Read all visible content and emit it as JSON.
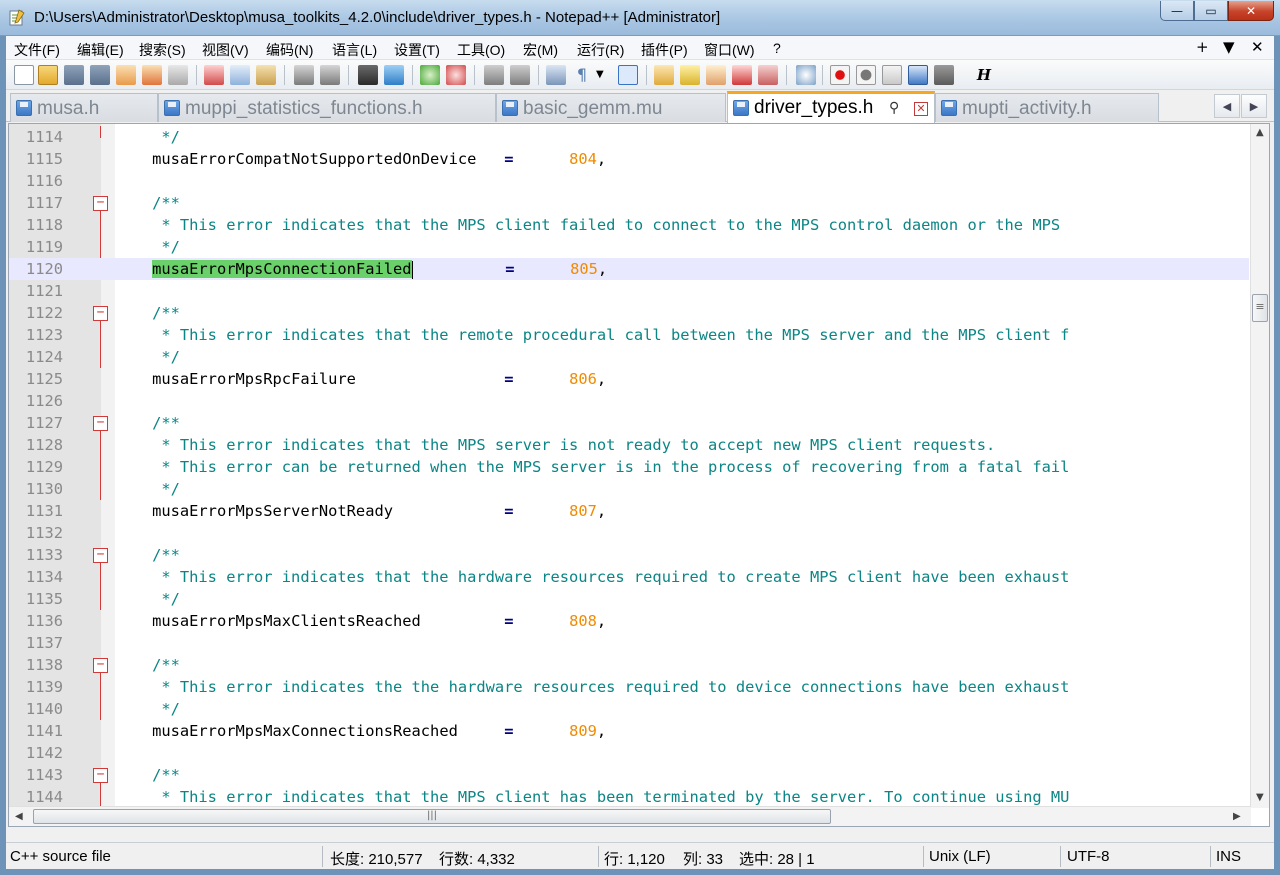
{
  "window": {
    "title": "D:\\Users\\Administrator\\Desktop\\musa_toolkits_4.2.0\\include\\driver_types.h - Notepad++ [Administrator]",
    "minimize": "—",
    "maximize": "▭",
    "close": "✕"
  },
  "menu": {
    "items": [
      "文件(F)",
      "编辑(E)",
      "搜索(S)",
      "视图(V)",
      "编码(N)",
      "语言(L)",
      "设置(T)",
      "工具(O)",
      "宏(M)",
      "运行(R)",
      "插件(P)",
      "窗口(W)",
      "?"
    ],
    "right": [
      "+",
      "▼",
      "✕"
    ]
  },
  "toolbar": {
    "icons": [
      "new-file-icon",
      "open-file-icon",
      "save-icon",
      "save-all-icon",
      "close-icon",
      "close-all-icon",
      "print-icon",
      "cut-icon",
      "copy-icon",
      "paste-icon",
      "undo-icon",
      "redo-icon",
      "find-icon",
      "replace-icon",
      "zoom-in-icon",
      "zoom-out-icon",
      "sync-vertical-icon",
      "sync-horizontal-icon",
      "word-wrap-icon",
      "show-all-chars-icon",
      "indent-guide-icon",
      "user-language-icon",
      "doc-map-icon",
      "function-list-icon",
      "folder-workspace-icon",
      "monitoring-icon",
      "record-macro-icon",
      "stop-record-icon",
      "play-macro-icon",
      "run-macro-multiple-icon",
      "save-macro-icon",
      "hex-icon"
    ],
    "hex_label": "H"
  },
  "tabs": [
    {
      "label": "musa.h",
      "active": false
    },
    {
      "label": "muppi_statistics_functions.h",
      "active": false
    },
    {
      "label": "basic_gemm.mu",
      "active": false
    },
    {
      "label": "driver_types.h",
      "active": true
    },
    {
      "label": "mupti_activity.h",
      "active": false
    }
  ],
  "tab_scroll": {
    "left": "◀",
    "right": "▶"
  },
  "editor": {
    "lines": [
      {
        "n": "1114",
        "kind": "comment",
        "text": "     */"
      },
      {
        "n": "1115",
        "kind": "enum",
        "name": "musaErrorCompatNotSupportedOnDevice",
        "value": "804"
      },
      {
        "n": "1116",
        "kind": "blank"
      },
      {
        "n": "1117",
        "kind": "comment-open",
        "text": "    /**"
      },
      {
        "n": "1118",
        "kind": "comment",
        "text": "     * This error indicates that the MPS client failed to connect to the MPS control daemon or the MPS"
      },
      {
        "n": "1119",
        "kind": "comment",
        "text": "     */"
      },
      {
        "n": "1120",
        "kind": "enum",
        "name": "musaErrorMpsConnectionFailed",
        "value": "805",
        "current": true,
        "selected": true
      },
      {
        "n": "1121",
        "kind": "blank"
      },
      {
        "n": "1122",
        "kind": "comment-open",
        "text": "    /**"
      },
      {
        "n": "1123",
        "kind": "comment",
        "text": "     * This error indicates that the remote procedural call between the MPS server and the MPS client f"
      },
      {
        "n": "1124",
        "kind": "comment",
        "text": "     */"
      },
      {
        "n": "1125",
        "kind": "enum",
        "name": "musaErrorMpsRpcFailure",
        "value": "806"
      },
      {
        "n": "1126",
        "kind": "blank"
      },
      {
        "n": "1127",
        "kind": "comment-open",
        "text": "    /**"
      },
      {
        "n": "1128",
        "kind": "comment",
        "text": "     * This error indicates that the MPS server is not ready to accept new MPS client requests."
      },
      {
        "n": "1129",
        "kind": "comment",
        "text": "     * This error can be returned when the MPS server is in the process of recovering from a fatal fail"
      },
      {
        "n": "1130",
        "kind": "comment",
        "text": "     */"
      },
      {
        "n": "1131",
        "kind": "enum",
        "name": "musaErrorMpsServerNotReady",
        "value": "807"
      },
      {
        "n": "1132",
        "kind": "blank"
      },
      {
        "n": "1133",
        "kind": "comment-open",
        "text": "    /**"
      },
      {
        "n": "1134",
        "kind": "comment",
        "text": "     * This error indicates that the hardware resources required to create MPS client have been exhaust"
      },
      {
        "n": "1135",
        "kind": "comment",
        "text": "     */"
      },
      {
        "n": "1136",
        "kind": "enum",
        "name": "musaErrorMpsMaxClientsReached",
        "value": "808"
      },
      {
        "n": "1137",
        "kind": "blank"
      },
      {
        "n": "1138",
        "kind": "comment-open",
        "text": "    /**"
      },
      {
        "n": "1139",
        "kind": "comment",
        "text": "     * This error indicates the the hardware resources required to device connections have been exhaust"
      },
      {
        "n": "1140",
        "kind": "comment",
        "text": "     */"
      },
      {
        "n": "1141",
        "kind": "enum",
        "name": "musaErrorMpsMaxConnectionsReached",
        "value": "809"
      },
      {
        "n": "1142",
        "kind": "blank"
      },
      {
        "n": "1143",
        "kind": "comment-open",
        "text": "    /**"
      },
      {
        "n": "1144",
        "kind": "comment",
        "text": "     * This error indicates that the MPS client has been terminated by the server. To continue using MU"
      },
      {
        "n": "1145",
        "kind": "comment",
        "text": "     */"
      }
    ],
    "hscroll_grip": "|||",
    "vscroll_grip": "≡"
  },
  "status": {
    "file_type": "C++ source file",
    "length": "长度: 210,577",
    "lines": "行数: 4,332",
    "row": "行: 1,120",
    "col": "列: 33",
    "selection": "选中: 28 | 1",
    "eol": "Unix (LF)",
    "encoding": "UTF-8",
    "mode": "INS"
  }
}
